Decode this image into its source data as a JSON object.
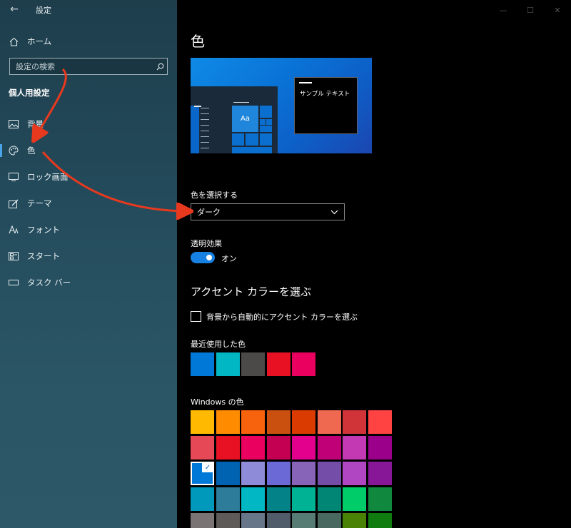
{
  "window": {
    "title": "設定",
    "back_glyph": "←",
    "min_glyph": "—",
    "max_glyph": "☐",
    "close_glyph": "✕"
  },
  "sidebar": {
    "home_label": "ホーム",
    "search_placeholder": "設定の検索",
    "section_heading": "個人用設定",
    "items": [
      {
        "label": "背景",
        "icon": "image-icon"
      },
      {
        "label": "色",
        "icon": "palette-icon",
        "active": true
      },
      {
        "label": "ロック画面",
        "icon": "lock-screen-icon"
      },
      {
        "label": "テーマ",
        "icon": "theme-icon"
      },
      {
        "label": "フォント",
        "icon": "font-icon"
      },
      {
        "label": "スタート",
        "icon": "start-icon"
      },
      {
        "label": "タスク バー",
        "icon": "taskbar-icon"
      }
    ]
  },
  "main": {
    "title": "色",
    "preview": {
      "tile_text": "Aa",
      "sample_text": "サンプル テキスト"
    },
    "choose_color_label": "色を選択する",
    "choose_color_value": "ダーク",
    "transparency_label": "透明効果",
    "transparency_state": "オン",
    "accent_heading": "アクセント カラーを選ぶ",
    "auto_accent_label": "背景から自動的にアクセント カラーを選ぶ",
    "recent_label": "最近使用した色",
    "recent_colors": [
      "#0078d7",
      "#00b7c3",
      "#4c4a48",
      "#e81123",
      "#ea005e"
    ],
    "windows_colors_label": "Windows の色",
    "windows_colors": [
      [
        "#ffb900",
        "#ff8c00",
        "#f7630c",
        "#ca5010",
        "#da3b01",
        "#ef6950",
        "#d13438",
        "#ff4343"
      ],
      [
        "#e74856",
        "#e81123",
        "#ea005e",
        "#c30052",
        "#e3008c",
        "#bf0077",
        "#c239b3",
        "#9a0089"
      ],
      [
        "#0078d7",
        "#0063b1",
        "#8e8cd8",
        "#6b69d6",
        "#8764b8",
        "#744da9",
        "#b146c2",
        "#881798"
      ],
      [
        "#0099bc",
        "#2d7d9a",
        "#00b7c3",
        "#038387",
        "#00b294",
        "#018574",
        "#00cc6a",
        "#10893e"
      ],
      [
        "#7a7574",
        "#5d5a58",
        "#68768a",
        "#515c6b",
        "#567c73",
        "#486860",
        "#498205",
        "#107c10"
      ]
    ],
    "selected_color": "#0078d7"
  },
  "annotation_color": "#e8391e"
}
